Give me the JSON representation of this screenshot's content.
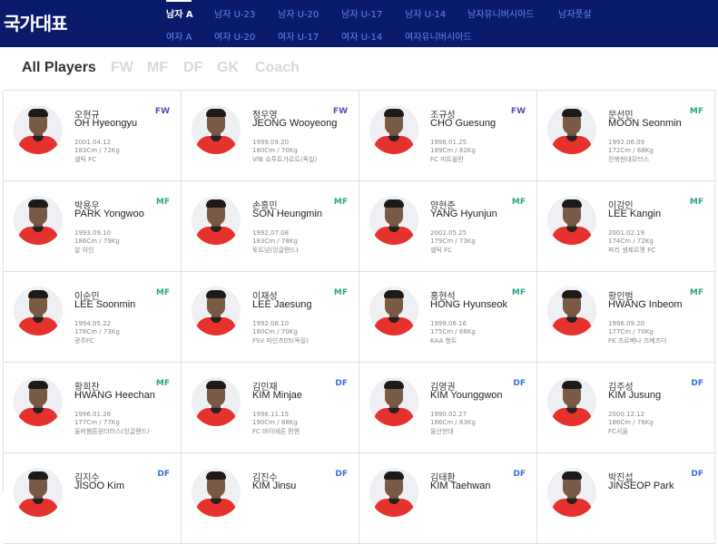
{
  "header": {
    "brand": "국가대표",
    "nav_row1": [
      "남자 A",
      "남자 U-23",
      "남자 U-20",
      "남자 U-17",
      "남자 U-14",
      "남자유니버시아드",
      "남자풋살"
    ],
    "nav_row2": [
      "여자 A",
      "여자 U-20",
      "여자 U-17",
      "여자 U-14",
      "여자유니버시아드"
    ],
    "active": "남자 A"
  },
  "filters": [
    "All Players",
    "FW",
    "MF",
    "DF",
    "GK",
    "Coach"
  ],
  "active_filter": "All Players",
  "players": [
    {
      "kname": "오현규",
      "ename": "OH Hyeongyu",
      "pos": "FW",
      "birth": "2001.04.12",
      "body": "183Cm / 72Kg",
      "club": "셀틱 FC"
    },
    {
      "kname": "정우영",
      "ename": "JEONG Wooyeong",
      "pos": "FW",
      "birth": "1999.09.20",
      "body": "180Cm / 70Kg",
      "club": "VfB 슈투트가르트(독일)"
    },
    {
      "kname": "조규성",
      "ename": "CHO Guesung",
      "pos": "FW",
      "birth": "1998.01.25",
      "body": "189Cm / 82Kg",
      "club": "FC 미트윌란"
    },
    {
      "kname": "문선민",
      "ename": "MOON Seonmin",
      "pos": "MF",
      "birth": "1992.06.09",
      "body": "172Cm / 68Kg",
      "club": "전북현대모터스"
    },
    {
      "kname": "박용우",
      "ename": "PARK Yongwoo",
      "pos": "MF",
      "birth": "1993.09.10",
      "body": "186Cm / 79Kg",
      "club": "알 아인"
    },
    {
      "kname": "손흥민",
      "ename": "SON Heungmin",
      "pos": "MF",
      "birth": "1992.07.08",
      "body": "183Cm / 78Kg",
      "club": "토트넘(잉글랜드)"
    },
    {
      "kname": "양현준",
      "ename": "YANG Hyunjun",
      "pos": "MF",
      "birth": "2002.05.25",
      "body": "179Cm / 73Kg",
      "club": "셀틱 FC"
    },
    {
      "kname": "이강인",
      "ename": "LEE Kangin",
      "pos": "MF",
      "birth": "2001.02.19",
      "body": "174Cm / 72Kg",
      "club": "파리 생제르맹 FC"
    },
    {
      "kname": "이순민",
      "ename": "LEE Soonmin",
      "pos": "MF",
      "birth": "1994.05.22",
      "body": "178Cm / 73Kg",
      "club": "광주FC"
    },
    {
      "kname": "이재성",
      "ename": "LEE Jaesung",
      "pos": "MF",
      "birth": "1992.08.10",
      "body": "180Cm / 70Kg",
      "club": "FSV 마인츠05(독일)"
    },
    {
      "kname": "홍현석",
      "ename": "HONG Hyunseok",
      "pos": "MF",
      "birth": "1999.06.16",
      "body": "175Cm / 66Kg",
      "club": "KAA 헨트"
    },
    {
      "kname": "황인범",
      "ename": "HWANG Inbeom",
      "pos": "MF",
      "birth": "1996.09.20",
      "body": "177Cm / 70Kg",
      "club": "FK 츠르베나 즈베즈다"
    },
    {
      "kname": "황희찬",
      "ename": "HWANG Heechan",
      "pos": "MF",
      "birth": "1996.01.26",
      "body": "177Cm / 77Kg",
      "club": "울버햄튼원더러스(잉글랜드)"
    },
    {
      "kname": "김민재",
      "ename": "KIM Minjae",
      "pos": "DF",
      "birth": "1996.11.15",
      "body": "190Cm / 88Kg",
      "club": "FC 바이에른 뮌헨"
    },
    {
      "kname": "김영권",
      "ename": "KIM Younggwon",
      "pos": "DF",
      "birth": "1990.02.27",
      "body": "186Cm / 83Kg",
      "club": "울산현대"
    },
    {
      "kname": "김주성",
      "ename": "KIM Jusung",
      "pos": "DF",
      "birth": "2000.12.12",
      "body": "186Cm / 76Kg",
      "club": "FC서울"
    },
    {
      "kname": "김지수",
      "ename": "JISOO Kim",
      "pos": "DF",
      "birth": "",
      "body": "",
      "club": ""
    },
    {
      "kname": "김진수",
      "ename": "KIM Jinsu",
      "pos": "DF",
      "birth": "",
      "body": "",
      "club": ""
    },
    {
      "kname": "김태환",
      "ename": "KIM Taehwan",
      "pos": "DF",
      "birth": "",
      "body": "",
      "club": ""
    },
    {
      "kname": "박진섭",
      "ename": "JINSEOP Park",
      "pos": "DF",
      "birth": "",
      "body": "",
      "club": ""
    }
  ],
  "colors": {
    "header_bg": "#0b1b6b",
    "nav_link": "#5f86f0",
    "FW": "#5b4db5",
    "MF": "#2ba58a",
    "DF": "#3b6fd6"
  }
}
